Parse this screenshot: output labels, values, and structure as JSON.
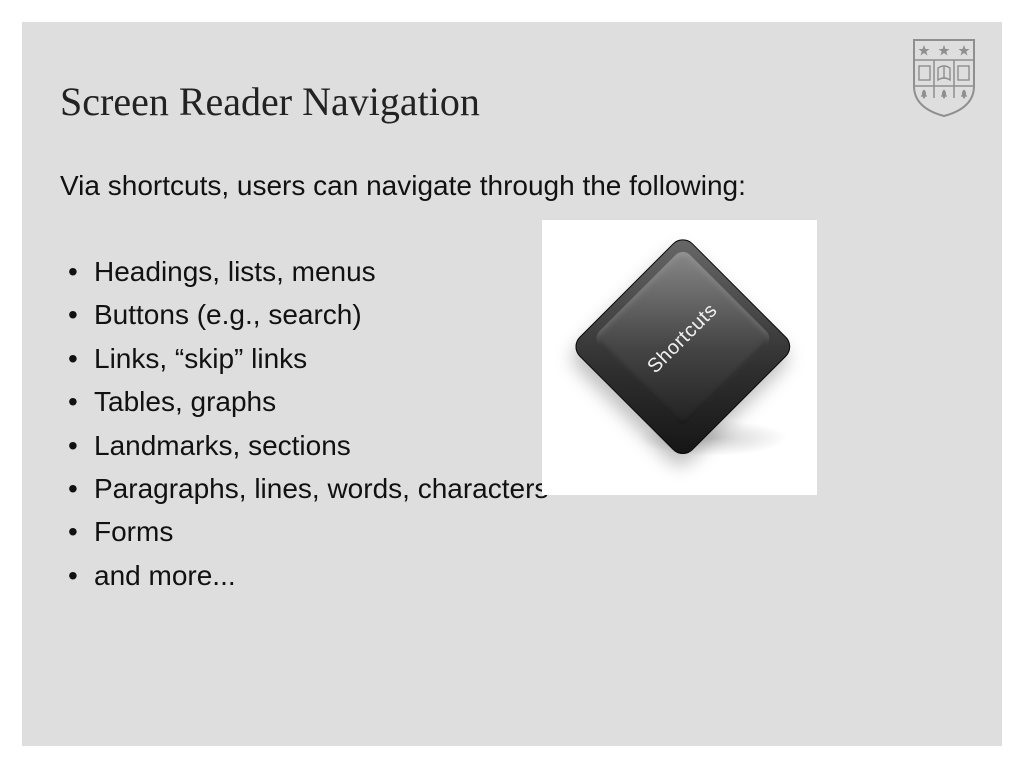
{
  "slide": {
    "title": "Screen Reader Navigation",
    "intro": "Via shortcuts, users can navigate through the following:",
    "bullets": [
      "Headings, lists, menus",
      "Buttons (e.g., search)",
      "Links, “skip” links",
      "Tables, graphs",
      "Landmarks, sections",
      "Paragraphs, lines, words, characters",
      "Forms",
      "and more..."
    ],
    "key_label": "Shortcuts"
  }
}
